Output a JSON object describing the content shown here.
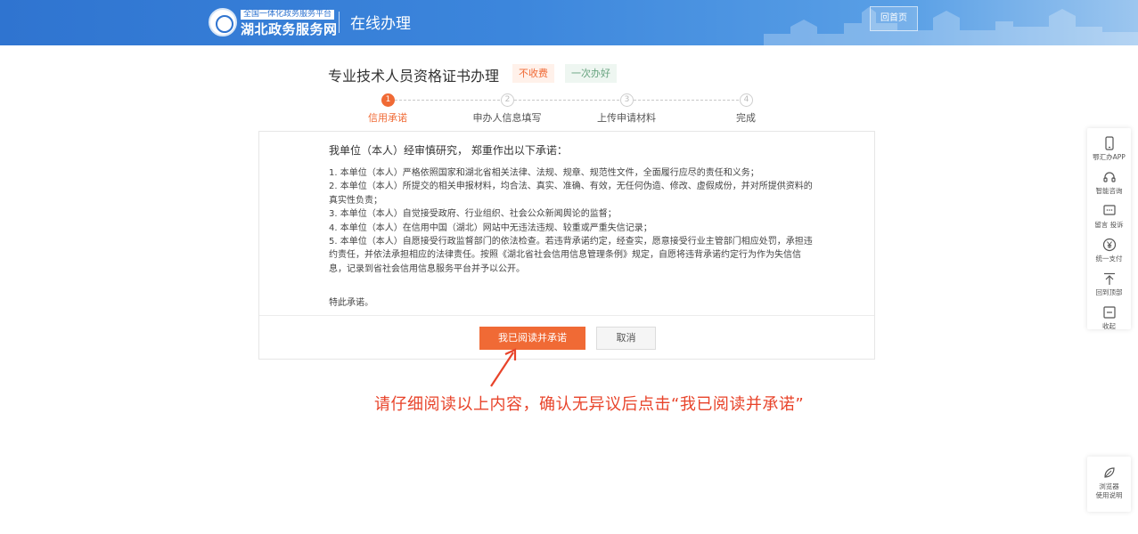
{
  "header": {
    "portal_tagline": "全国一体化政务服务平台",
    "portal_name": "湖北政务服务网",
    "section": "在线办理",
    "home_button": "回首页"
  },
  "page": {
    "title": "专业技术人员资格证书办理",
    "tags": [
      "不收费",
      "一次办好"
    ]
  },
  "steps": [
    {
      "number": "1",
      "label": "信用承诺",
      "active": true
    },
    {
      "number": "2",
      "label": "申办人信息填写",
      "active": false
    },
    {
      "number": "3",
      "label": "上传申请材料",
      "active": false
    },
    {
      "number": "4",
      "label": "完成",
      "active": false
    }
  ],
  "commitment": {
    "intro": "我单位（本人）经审慎研究， 郑重作出以下承诺：",
    "items": [
      "1. 本单位（本人）严格依照国家和湖北省相关法律、法规、规章、规范性文件，全面履行应尽的责任和义务；",
      "2. 本单位（本人）所提交的相关申报材料，均合法、真实、准确、有效，无任何伪造、修改、虚假成份，并对所提供资料的真实性负责；",
      "3. 本单位（本人）自觉接受政府、行业组织、社会公众新闻舆论的监督；",
      "4. 本单位（本人）在信用中国（湖北）网站中无违法违规、较重或严重失信记录；",
      "5. 本单位（本人）自愿接受行政监督部门的依法检查。若违背承诺约定，经查实，愿意接受行业主管部门相应处罚，承担违约责任，并依法承担相应的法律责任。按照《湖北省社会信用信息管理条例》规定，自愿将违背承诺约定行为作为失信信息，记录到省社会信用信息服务平台并予以公开。"
    ],
    "closing": "特此承诺。",
    "confirm_button": "我已阅读并承诺",
    "cancel_button": "取消"
  },
  "annotation": {
    "text": "请仔细阅读以上内容，确认无异议后点击“我已阅读并承诺”"
  },
  "float_bar": {
    "items": [
      {
        "label": "鄂汇办APP",
        "icon": "phone-icon"
      },
      {
        "label": "智能咨询",
        "icon": "headset-icon"
      },
      {
        "label": "留言 投诉",
        "icon": "message-icon"
      },
      {
        "label": "统一支付",
        "icon": "yuan-icon"
      },
      {
        "label": "回到顶部",
        "icon": "arrow-up-icon"
      },
      {
        "label": "收起",
        "icon": "collapse-icon"
      }
    ],
    "help": {
      "line1": "浏览器",
      "line2": "使用说明",
      "icon": "leaf-icon"
    }
  },
  "colors": {
    "header_blue": "#2f74d0",
    "accent_orange": "#f06a35",
    "annotation_red": "#e8432a"
  }
}
